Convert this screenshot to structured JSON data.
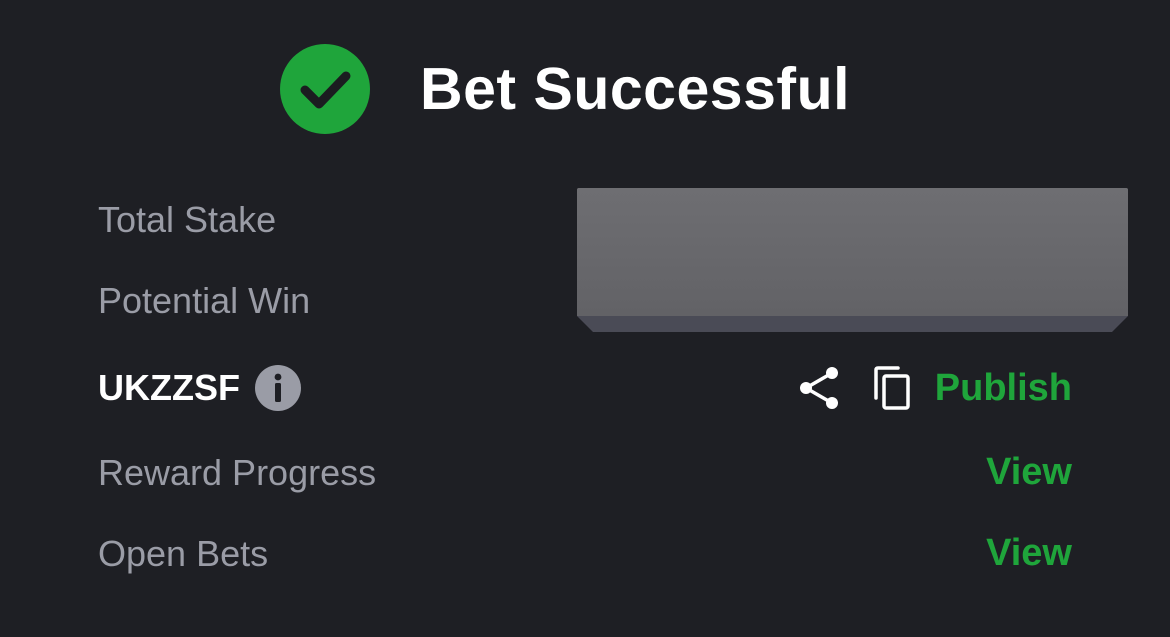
{
  "header": {
    "title": "Bet Successful",
    "icon": "check-circle-icon",
    "icon_color": "#1fa53b"
  },
  "details": {
    "total_stake_label": "Total Stake",
    "potential_win_label": "Potential Win",
    "redacted_values": "redacted-block"
  },
  "booking": {
    "code": "UKZZSF",
    "info_icon": "info-icon",
    "share_icon": "share-icon",
    "copy_icon": "copy-icon",
    "publish_label": "Publish"
  },
  "links": {
    "reward_progress_label": "Reward Progress",
    "reward_progress_action": "View",
    "open_bets_label": "Open Bets",
    "open_bets_action": "View"
  },
  "colors": {
    "background": "#1e1f24",
    "accent_green": "#1fa53b",
    "label_gray": "#9a9ca6",
    "text_white": "#ffffff"
  }
}
